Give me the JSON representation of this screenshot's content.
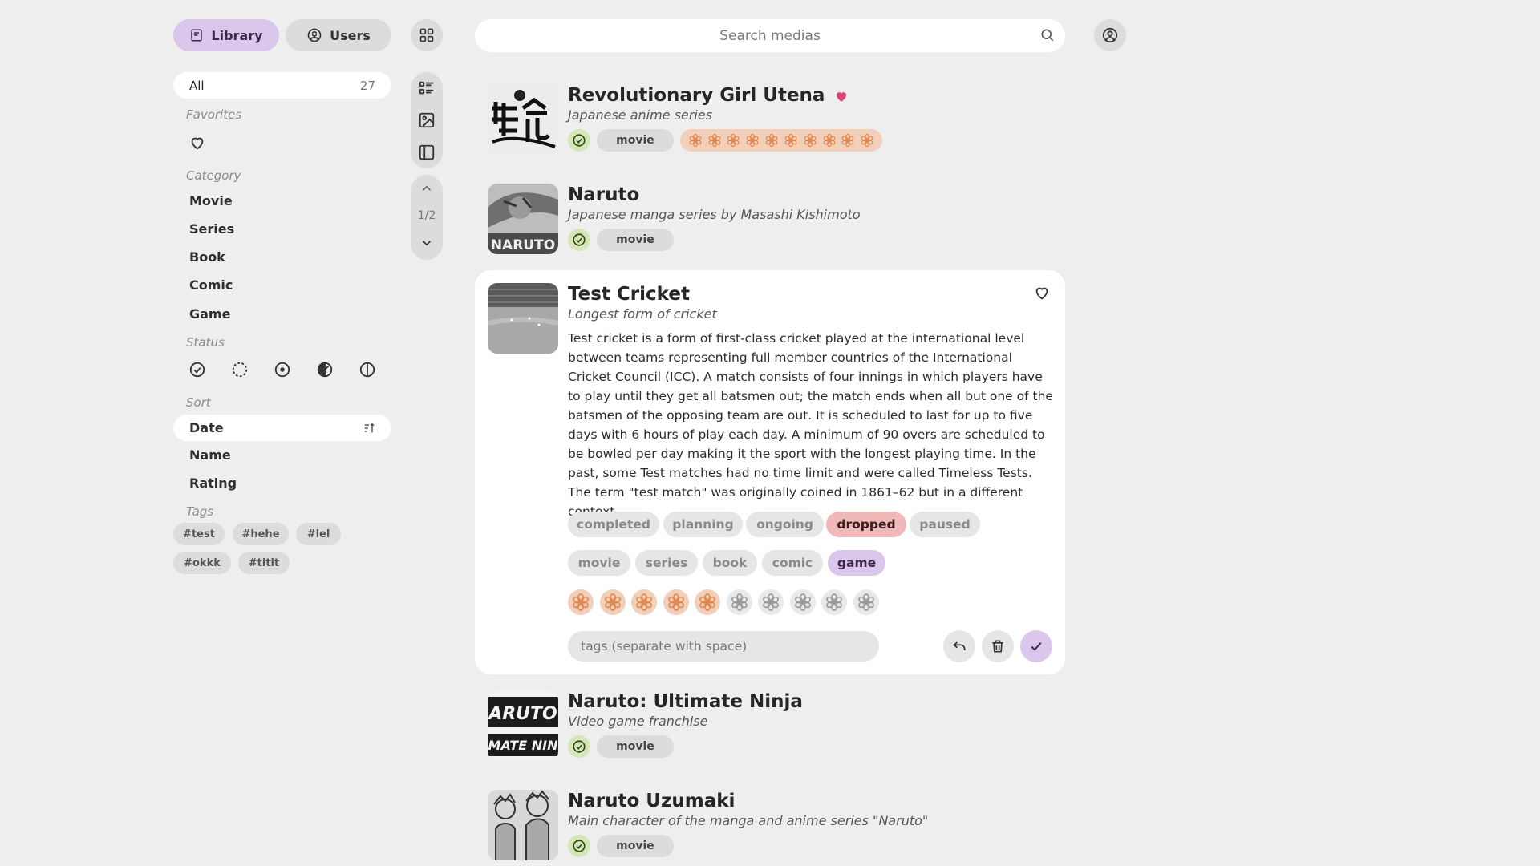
{
  "nav": {
    "library_label": "Library",
    "users_label": "Users"
  },
  "search": {
    "placeholder": "Search medias"
  },
  "sidebar": {
    "all_label": "All",
    "all_count": "27",
    "favorites_label": "Favorites",
    "category_label": "Category",
    "categories": [
      "Movie",
      "Series",
      "Book",
      "Comic",
      "Game"
    ],
    "status_label": "Status",
    "sort_label": "Sort",
    "sort_options": [
      "Date",
      "Name",
      "Rating"
    ],
    "tags_label": "Tags",
    "tags": [
      "#test",
      "#hehe",
      "#lel",
      "#okkk",
      "#titit"
    ]
  },
  "pagination": {
    "page": "1/2"
  },
  "media": [
    {
      "title": "Revolutionary Girl Utena",
      "subtitle": "Japanese anime series",
      "category": "movie",
      "status": "completed",
      "favorite": true,
      "rating": 10
    },
    {
      "title": "Naruto",
      "subtitle": "Japanese manga series by Masashi Kishimoto",
      "category": "movie",
      "status": "completed",
      "favorite": false,
      "rating": 0
    },
    {
      "title": "Test Cricket",
      "subtitle": "Longest form of cricket",
      "description": "Test cricket is a form of first-class cricket played at the international level between teams representing full member countries of the International Cricket Council (ICC). A match consists of four innings in which players have to play until they get all batsmen out; the match ends when all but one of the batsmen of the opposing team are out. It is scheduled to last for up to five days with 6 hours of play each day. A minimum of 90 overs are scheduled to be bowled per day making it the sport with the longest playing time. In the past, some Test matches had no time limit and were called Timeless Tests. The term \"test match\" was originally coined in 1861–62 but in a different context.",
      "statuses": [
        "completed",
        "planning",
        "ongoing",
        "dropped",
        "paused"
      ],
      "selected_status": "dropped",
      "categories": [
        "movie",
        "series",
        "book",
        "comic",
        "game"
      ],
      "selected_category": "game",
      "rating": 5,
      "rating_max": 10,
      "tags_placeholder": "tags (separate with space)"
    },
    {
      "title": "Naruto: Ultimate Ninja",
      "subtitle": "Video game franchise",
      "category": "movie",
      "status": "completed",
      "favorite": false,
      "rating": 0
    },
    {
      "title": "Naruto Uzumaki",
      "subtitle": "Main character of the manga and anime series \"Naruto\"",
      "category": "movie",
      "status": "completed",
      "favorite": false,
      "rating": 0
    }
  ],
  "colors": {
    "accent_purple": "#dcc7ec",
    "rating_orange": "#f2cfb8",
    "flower_orange": "#e08850",
    "dropped_red": "#f0b8b8",
    "completed_green": "#d6e6b8",
    "favorite_pink": "#e0457a"
  },
  "icons": {
    "library": "book-icon",
    "users": "user-circle-icon",
    "grid": "grid-icon",
    "search": "search-icon",
    "account": "account-icon",
    "favorite": "heart-icon",
    "rating": "flower-icon",
    "undo": "undo-icon",
    "delete": "trash-icon",
    "confirm": "check-icon"
  }
}
